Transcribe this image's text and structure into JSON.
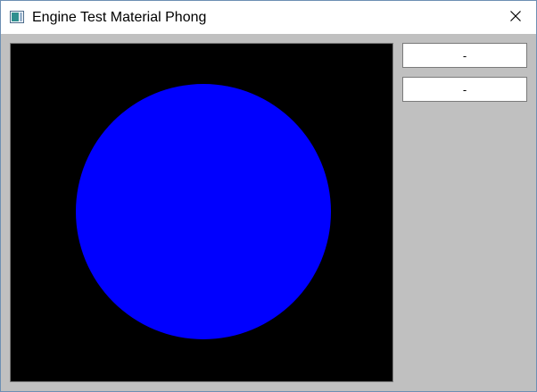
{
  "window": {
    "title": "Engine Test Material Phong",
    "icon": "app-window-icon",
    "close_icon": "close-icon"
  },
  "viewport": {
    "background_color": "#000000",
    "sphere_color": "#0000ff"
  },
  "side_panel": {
    "buttons": [
      {
        "label": "-"
      },
      {
        "label": "-"
      }
    ]
  },
  "colors": {
    "window_background": "#c0c0c0",
    "titlebar": "#ffffff"
  }
}
